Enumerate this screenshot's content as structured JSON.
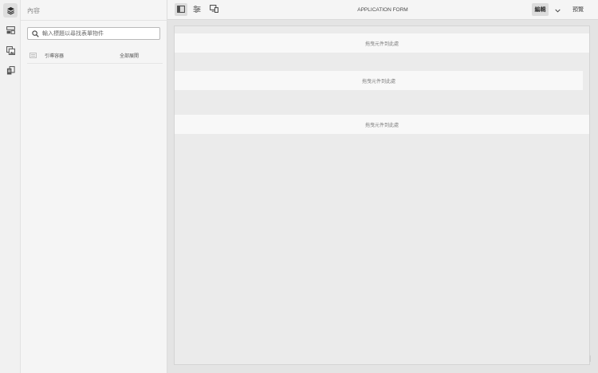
{
  "rail": {
    "items": [
      {
        "icon": "layers-icon",
        "active": true
      },
      {
        "icon": "components-icon",
        "active": false
      },
      {
        "icon": "assets-icon",
        "active": false
      },
      {
        "icon": "data-sources-icon",
        "active": false
      }
    ]
  },
  "panel": {
    "title": "內容",
    "search_placeholder": "輸入標題以尋找表單物件",
    "tree": {
      "root_label": "引導容器",
      "expand_all_label": "全部展開"
    }
  },
  "toolbar": {
    "form_title": "APPLICATION FORM",
    "edit_label": "編輯",
    "preview_label": "預覽"
  },
  "canvas": {
    "drop_zones": [
      {
        "label": "拖曳元件到此處"
      },
      {
        "label": "拖曳元件到此處"
      },
      {
        "label": "拖曳元件到此處"
      }
    ]
  },
  "colors": {
    "background": "#e4e4e4",
    "panel": "#f5f5f5",
    "canvas": "#ebebeb",
    "drop_zone": "#f8f8f8",
    "active_button": "#dcdcdc"
  }
}
